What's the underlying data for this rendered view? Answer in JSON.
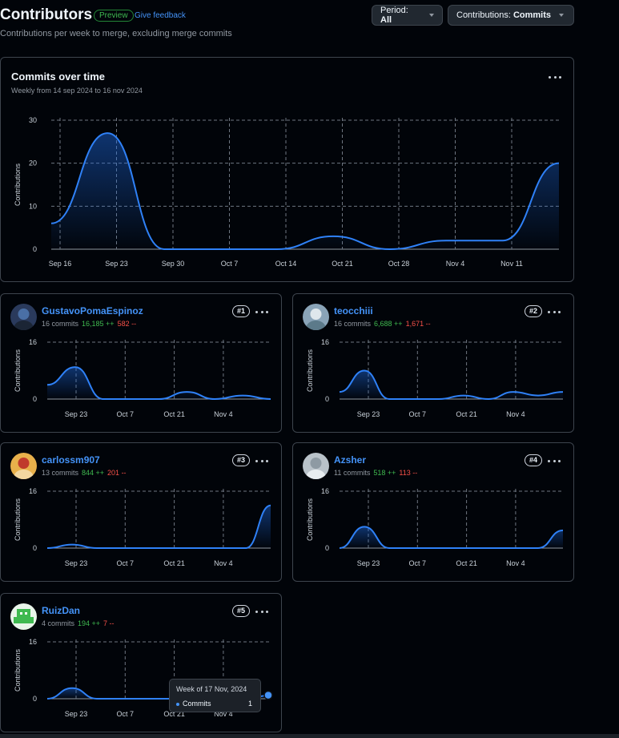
{
  "header": {
    "title": "Contributors",
    "preview_badge": "Preview",
    "feedback_link": "Give feedback",
    "subtitle": "Contributions per week to merge, excluding merge commits",
    "period_key": "Period:",
    "period_value": "All",
    "contrib_key": "Contributions:",
    "contrib_value": "Commits"
  },
  "colors": {
    "accent": "#4493f8",
    "line": "#2f81f7",
    "additions": "#3fb950",
    "deletions": "#f85149",
    "border": "#3d444d"
  },
  "main_chart": {
    "title": "Commits over time",
    "subtitle": "Weekly from 14 sep 2024 to 16 nov 2024",
    "chart_data": {
      "type": "area",
      "ylabel": "Contributions",
      "ylim": [
        0,
        30
      ],
      "yticks": [
        "0",
        "10",
        "20",
        "30"
      ],
      "x_ticks": [
        "Sep 16",
        "Sep 23",
        "Sep 30",
        "Oct 7",
        "Oct 14",
        "Oct 21",
        "Oct 28",
        "Nov 4",
        "Nov 11"
      ],
      "series": [
        {
          "values": [
            6,
            27,
            0,
            0,
            0,
            3,
            0,
            2,
            2,
            20
          ]
        }
      ],
      "grid": true
    }
  },
  "contributors": [
    {
      "name": "GustavoPomaEspinoz",
      "commits": "16 commits",
      "additions": "16,185 ++",
      "deletions": "582 --",
      "rank": "#1",
      "avatar_icon": "user-avatar-icon",
      "chart_data": {
        "type": "area",
        "ylabel": "Contributions",
        "ylim": [
          0,
          16
        ],
        "yticks": [
          "0",
          "16"
        ],
        "x_ticks": [
          "Sep 23",
          "Oct 7",
          "Oct 21",
          "Nov 4"
        ],
        "series": [
          {
            "values": [
              4,
              9,
              0,
              0,
              0,
              2,
              0,
              1,
              0
            ]
          }
        ]
      }
    },
    {
      "name": "teocchiii",
      "commits": "16 commits",
      "additions": "6,688 ++",
      "deletions": "1,671 --",
      "rank": "#2",
      "avatar_icon": "user-avatar-icon",
      "chart_data": {
        "type": "area",
        "ylabel": "Contributions",
        "ylim": [
          0,
          16
        ],
        "yticks": [
          "0",
          "16"
        ],
        "x_ticks": [
          "Sep 23",
          "Oct 7",
          "Oct 21",
          "Nov 4"
        ],
        "series": [
          {
            "values": [
              2,
              8,
              0,
              0,
              0,
              1,
              0,
              2,
              1,
              2
            ]
          }
        ]
      }
    },
    {
      "name": "carlossm907",
      "commits": "13 commits",
      "additions": "844 ++",
      "deletions": "201 --",
      "rank": "#3",
      "avatar_icon": "user-avatar-icon",
      "chart_data": {
        "type": "area",
        "ylabel": "Contributions",
        "ylim": [
          0,
          16
        ],
        "yticks": [
          "0",
          "16"
        ],
        "x_ticks": [
          "Sep 23",
          "Oct 7",
          "Oct 21",
          "Nov 4"
        ],
        "series": [
          {
            "values": [
              0,
              1,
              0,
              0,
              0,
              0,
              0,
              0,
              0,
              12
            ]
          }
        ]
      }
    },
    {
      "name": "Azsher",
      "commits": "11 commits",
      "additions": "518 ++",
      "deletions": "113 --",
      "rank": "#4",
      "avatar_icon": "user-avatar-icon",
      "chart_data": {
        "type": "area",
        "ylabel": "Contributions",
        "ylim": [
          0,
          16
        ],
        "yticks": [
          "0",
          "16"
        ],
        "x_ticks": [
          "Sep 23",
          "Oct 7",
          "Oct 21",
          "Nov 4"
        ],
        "series": [
          {
            "values": [
              0,
              6,
              0,
              0,
              0,
              0,
              0,
              0,
              0,
              5
            ]
          }
        ]
      }
    },
    {
      "name": "RuizDan",
      "commits": "4 commits",
      "additions": "194 ++",
      "deletions": "7 --",
      "rank": "#5",
      "avatar_icon": "user-avatar-icon",
      "chart_data": {
        "type": "area",
        "ylabel": "Contributions",
        "ylim": [
          0,
          16
        ],
        "yticks": [
          "0",
          "16"
        ],
        "x_ticks": [
          "Sep 23",
          "Oct 7",
          "Oct 21",
          "Nov 4"
        ],
        "series": [
          {
            "values": [
              0,
              3,
              0,
              0,
              0,
              0,
              0,
              0,
              0,
              1
            ]
          }
        ]
      }
    }
  ],
  "tooltip": {
    "title": "Week of 17 Nov, 2024",
    "label": "Commits",
    "value": "1"
  }
}
